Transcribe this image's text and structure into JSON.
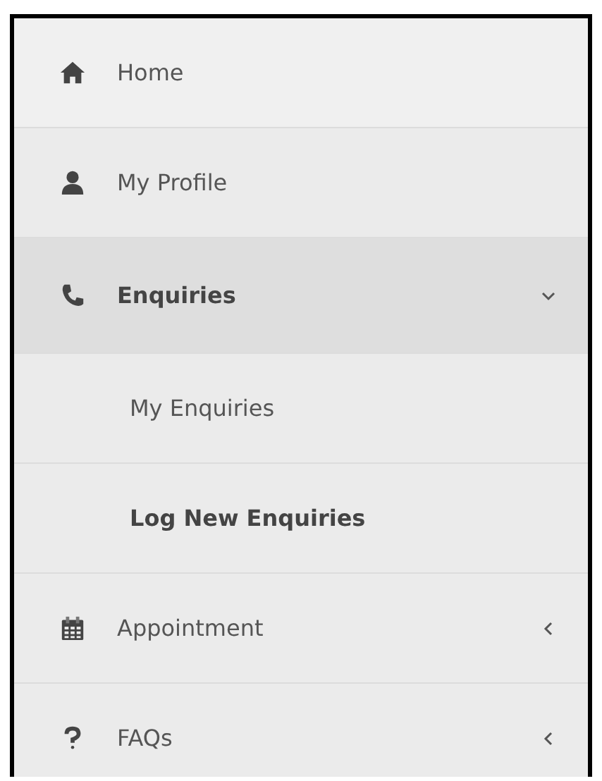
{
  "menu": [
    {
      "label": "Home"
    },
    {
      "label": "My Profile"
    },
    {
      "label": "Enquiries",
      "expanded": true,
      "children": [
        {
          "label": "My Enquiries",
          "selected": false
        },
        {
          "label": "Log New Enquiries",
          "selected": true
        }
      ]
    },
    {
      "label": "Appointment",
      "expanded": false
    },
    {
      "label": "FAQs",
      "expanded": false
    }
  ]
}
